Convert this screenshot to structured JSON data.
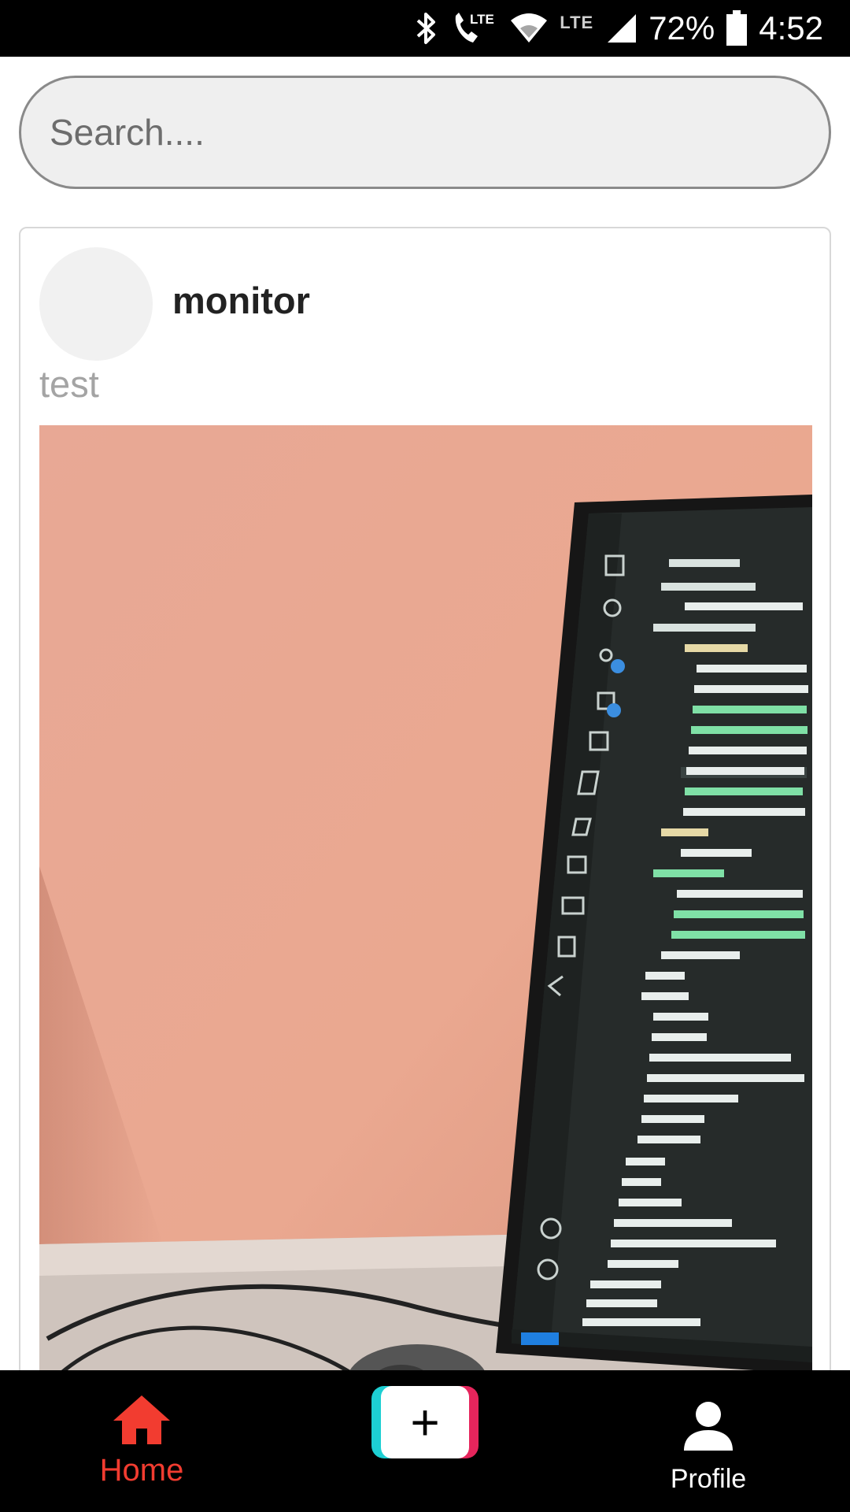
{
  "status_bar": {
    "network_label": "LTE",
    "secondary_network_label": "LTE",
    "battery": "72%",
    "time": "4:52",
    "icons": [
      "bluetooth-icon",
      "call-lte-icon",
      "wifi-icon",
      "cell-signal-icon",
      "battery-icon"
    ]
  },
  "search": {
    "placeholder": "Search....",
    "value": ""
  },
  "feed": {
    "posts": [
      {
        "author": "monitor",
        "caption": "test",
        "media": "photo of a monitor showing a code editor file explorer against a pink wall"
      }
    ]
  },
  "bottom_nav": {
    "home_label": "Home",
    "add_label": "+",
    "profile_label": "Profile",
    "active": "Home",
    "colors": {
      "active": "#f23c30",
      "inactive": "#ffffff",
      "background": "#000000"
    }
  }
}
